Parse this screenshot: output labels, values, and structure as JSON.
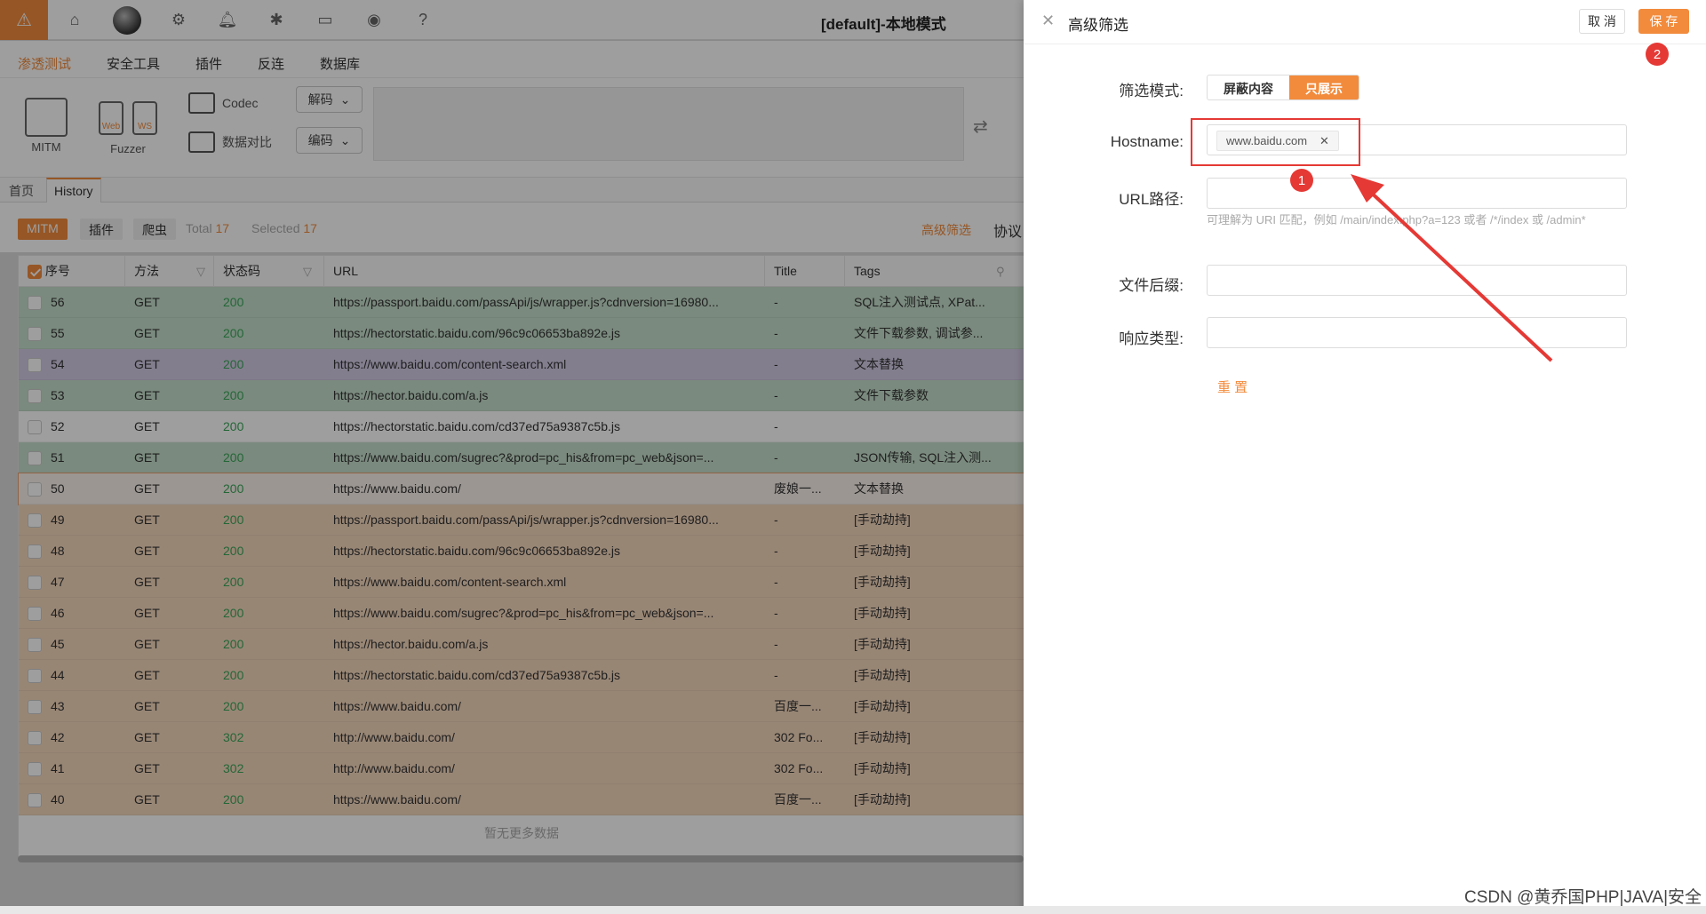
{
  "window": {
    "title": "[default]-本地模式"
  },
  "menu": [
    "渗透测试",
    "安全工具",
    "插件",
    "反连",
    "数据库"
  ],
  "toolbar": {
    "mitm_label": "MITM",
    "fuzzer_label": "Fuzzer",
    "fuzzer_tags": [
      "Web",
      "WS"
    ],
    "codec_label": "Codec",
    "diff_label": "数据对比",
    "decode_label": "解码",
    "encode_label": "编码"
  },
  "subtabs": [
    "首页",
    "History"
  ],
  "filter": {
    "chips": [
      "MITM",
      "插件",
      "爬虫"
    ],
    "total_label": "Total",
    "total": "17",
    "selected_label": "Selected",
    "selected": "17",
    "adv_label": "高级筛选",
    "proto_label": "协议"
  },
  "table": {
    "headers": [
      "序号",
      "方法",
      "状态码",
      "URL",
      "Title",
      "Tags"
    ],
    "rows": [
      {
        "id": "56",
        "method": "GET",
        "status": "200",
        "url": "https://passport.baidu.com/passApi/js/wrapper.js?cdnversion=16980...",
        "title": "-",
        "tags": "SQL注入测试点, XPat...",
        "bg": "#c6dfcc"
      },
      {
        "id": "55",
        "method": "GET",
        "status": "200",
        "url": "https://hectorstatic.baidu.com/96c9c06653ba892e.js",
        "title": "-",
        "tags": "文件下载参数, 调试参...",
        "bg": "#c6dfcc"
      },
      {
        "id": "54",
        "method": "GET",
        "status": "200",
        "url": "https://www.baidu.com/content-search.xml",
        "title": "-",
        "tags": "文本替换",
        "bg": "#d3cbe6"
      },
      {
        "id": "53",
        "method": "GET",
        "status": "200",
        "url": "https://hector.baidu.com/a.js",
        "title": "-",
        "tags": "文件下载参数",
        "bg": "#c6dfcc"
      },
      {
        "id": "52",
        "method": "GET",
        "status": "200",
        "url": "https://hectorstatic.baidu.com/cd37ed75a9387c5b.js",
        "title": "-",
        "tags": "",
        "bg": "#ffffff"
      },
      {
        "id": "51",
        "method": "GET",
        "status": "200",
        "url": "https://www.baidu.com/sugrec?&prod=pc_his&from=pc_web&json=...",
        "title": "-",
        "tags": "JSON传输, SQL注入测...",
        "bg": "#c6dfcc"
      },
      {
        "id": "50",
        "method": "GET",
        "status": "200",
        "url": "https://www.baidu.com/",
        "title": "废娘一...",
        "tags": "文本替换",
        "bg": "#fbf3ec"
      },
      {
        "id": "49",
        "method": "GET",
        "status": "200",
        "url": "https://passport.baidu.com/passApi/js/wrapper.js?cdnversion=16980...",
        "title": "-",
        "tags": "[手动劫持]",
        "bg": "#f6d8bd"
      },
      {
        "id": "48",
        "method": "GET",
        "status": "200",
        "url": "https://hectorstatic.baidu.com/96c9c06653ba892e.js",
        "title": "-",
        "tags": "[手动劫持]",
        "bg": "#f6d8bd"
      },
      {
        "id": "47",
        "method": "GET",
        "status": "200",
        "url": "https://www.baidu.com/content-search.xml",
        "title": "-",
        "tags": "[手动劫持]",
        "bg": "#f6d8bd"
      },
      {
        "id": "46",
        "method": "GET",
        "status": "200",
        "url": "https://www.baidu.com/sugrec?&prod=pc_his&from=pc_web&json=...",
        "title": "-",
        "tags": "[手动劫持]",
        "bg": "#f6d8bd"
      },
      {
        "id": "45",
        "method": "GET",
        "status": "200",
        "url": "https://hector.baidu.com/a.js",
        "title": "-",
        "tags": "[手动劫持]",
        "bg": "#f6d8bd"
      },
      {
        "id": "44",
        "method": "GET",
        "status": "200",
        "url": "https://hectorstatic.baidu.com/cd37ed75a9387c5b.js",
        "title": "-",
        "tags": "[手动劫持]",
        "bg": "#f6d8bd"
      },
      {
        "id": "43",
        "method": "GET",
        "status": "200",
        "url": "https://www.baidu.com/",
        "title": "百度一...",
        "tags": "[手动劫持]",
        "bg": "#f6d8bd"
      },
      {
        "id": "42",
        "method": "GET",
        "status": "302",
        "url": "http://www.baidu.com/",
        "title": "302 Fo...",
        "tags": "[手动劫持]",
        "bg": "#f6d8bd"
      },
      {
        "id": "41",
        "method": "GET",
        "status": "302",
        "url": "http://www.baidu.com/",
        "title": "302 Fo...",
        "tags": "[手动劫持]",
        "bg": "#f6d8bd"
      },
      {
        "id": "40",
        "method": "GET",
        "status": "200",
        "url": "https://www.baidu.com/",
        "title": "百度一...",
        "tags": "[手动劫持]",
        "bg": "#f6d8bd"
      }
    ],
    "empty_text": "暂无更多数据"
  },
  "drawer": {
    "title": "高级筛选",
    "cancel": "取 消",
    "save": "保 存",
    "mode_label": "筛选模式:",
    "mode_options": [
      "屏蔽内容",
      "只展示"
    ],
    "hostname_label": "Hostname:",
    "hostname_tag": "www.baidu.com",
    "url_label": "URL路径:",
    "url_hint": "可理解为 URI 匹配，例如 /main/index.php?a=123 或者 /*/index 或 /admin*",
    "suffix_label": "文件后缀:",
    "content_type_label": "响应类型:",
    "reset": "重 置"
  },
  "annotations": {
    "badge1": "1",
    "badge2": "2"
  },
  "watermark": "CSDN @黄乔国PHP|JAVA|安全",
  "colors": {
    "accent": "#f28b3c",
    "status_ok": "#3aa65a",
    "annotation": "#e53935"
  }
}
